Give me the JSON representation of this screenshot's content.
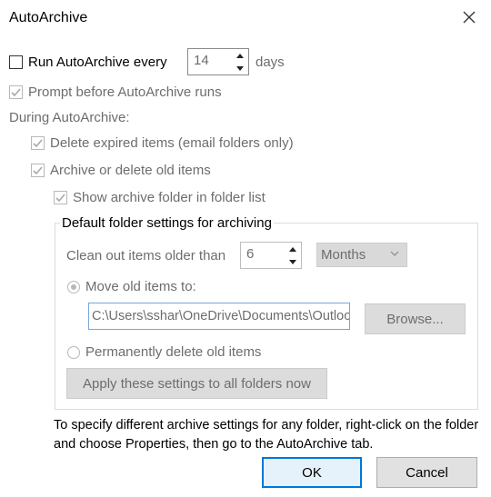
{
  "window": {
    "title": "AutoArchive"
  },
  "run_every": {
    "label": "Run AutoArchive every",
    "value": "14",
    "unit": "days",
    "checked": false
  },
  "prompt": {
    "label": "Prompt before AutoArchive runs",
    "checked": true
  },
  "during": {
    "label": "During AutoArchive:"
  },
  "delete_expired": {
    "label": "Delete expired items (email folders only)",
    "checked": true
  },
  "archive_old": {
    "label": "Archive or delete old items",
    "checked": true
  },
  "show_folder": {
    "label": "Show archive folder in folder list",
    "checked": true
  },
  "group": {
    "title": "Default folder settings for archiving",
    "clean_label": "Clean out items older than",
    "clean_value": "6",
    "clean_unit": "Months",
    "move_label": "Move old items to:",
    "move_selected": true,
    "path": "C:\\Users\\sshar\\OneDrive\\Documents\\Outlook Files\\archive.pst",
    "browse_label": "Browse...",
    "delete_label": "Permanently delete old items",
    "apply_label": "Apply these settings to all folders now"
  },
  "info": {
    "text": "To specify different archive settings for any folder, right-click on the folder and choose Properties, then go to the AutoArchive tab."
  },
  "buttons": {
    "ok": "OK",
    "cancel": "Cancel"
  }
}
